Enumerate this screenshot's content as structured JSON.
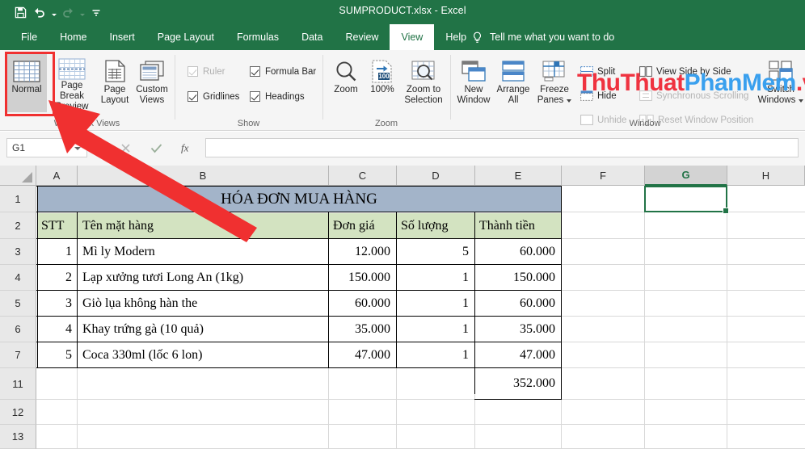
{
  "titlebar": {
    "document_title": "SUMPRODUCT.xlsx  -  Excel",
    "qat": [
      {
        "name": "save-icon",
        "label": "Save"
      },
      {
        "name": "undo-icon",
        "label": "Undo"
      },
      {
        "name": "redo-icon",
        "label": "Redo"
      },
      {
        "name": "customize-qat-icon",
        "label": "Customize Quick Access Toolbar"
      }
    ]
  },
  "ribbon_tabs": {
    "items": [
      {
        "label": "File",
        "active": false
      },
      {
        "label": "Home",
        "active": false
      },
      {
        "label": "Insert",
        "active": false
      },
      {
        "label": "Page Layout",
        "active": false
      },
      {
        "label": "Formulas",
        "active": false
      },
      {
        "label": "Data",
        "active": false
      },
      {
        "label": "Review",
        "active": false
      },
      {
        "label": "View",
        "active": true
      },
      {
        "label": "Help",
        "active": false
      }
    ],
    "tellme": "Tell me what you want to do"
  },
  "ribbon": {
    "groups": {
      "workbook_views": {
        "label": "Workbook Views",
        "buttons": [
          {
            "label": "Normal",
            "selected": true
          },
          {
            "label": "Page Break Preview",
            "line1": "Page Break",
            "line2": "Preview",
            "selected": false
          },
          {
            "label": "Page Layout",
            "line1": "Page",
            "line2": "Layout",
            "selected": false
          },
          {
            "label": "Custom Views",
            "line1": "Custom",
            "line2": "Views",
            "selected": false
          }
        ]
      },
      "show": {
        "label": "Show",
        "checkboxes": [
          {
            "label": "Ruler",
            "checked": true,
            "disabled": true
          },
          {
            "label": "Formula Bar",
            "checked": true,
            "disabled": false
          },
          {
            "label": "Gridlines",
            "checked": true,
            "disabled": false
          },
          {
            "label": "Headings",
            "checked": true,
            "disabled": false
          }
        ]
      },
      "zoom": {
        "label": "Zoom",
        "buttons": [
          {
            "label": "Zoom"
          },
          {
            "label": "100%"
          },
          {
            "label": "Zoom to Selection",
            "line1": "Zoom to",
            "line2": "Selection"
          }
        ]
      },
      "window": {
        "label": "Window",
        "big_buttons": [
          {
            "label": "New Window",
            "line1": "New",
            "line2": "Window"
          },
          {
            "label": "Arrange All",
            "line1": "Arrange",
            "line2": "All"
          },
          {
            "label": "Freeze Panes",
            "line1": "Freeze",
            "line2": "Panes"
          },
          {
            "label": "Switch Windows",
            "line1": "Switch",
            "line2": "Windows"
          }
        ],
        "small_buttons": [
          {
            "label": "Split",
            "disabled": false
          },
          {
            "label": "Hide",
            "disabled": false
          },
          {
            "label": "Unhide",
            "disabled": true
          },
          {
            "label": "View Side by Side",
            "disabled": false
          },
          {
            "label": "Synchronous Scrolling",
            "disabled": true
          },
          {
            "label": "Reset Window Position",
            "disabled": true
          }
        ]
      }
    }
  },
  "formula_bar": {
    "name_box_value": "G1",
    "formula_value": "",
    "cancel_icon": "cancel-icon",
    "enter_icon": "enter-icon",
    "function_icon": "insert-function-icon"
  },
  "sheet": {
    "columns": [
      "A",
      "B",
      "C",
      "D",
      "E",
      "F",
      "G",
      "H"
    ],
    "selected_column": "G",
    "rows": [
      "1",
      "2",
      "3",
      "4",
      "5",
      "6",
      "7",
      "11",
      "12",
      "13"
    ],
    "selected_cell": "G1",
    "title_row": {
      "text": "HÓA ĐƠN MUA HÀNG",
      "fill": "#a3b4c9"
    },
    "header_row": {
      "cells": [
        "STT",
        "Tên mặt hàng",
        "Đơn giá",
        "Số lượng",
        "Thành tiền"
      ],
      "fill": "#d3e3c1"
    },
    "data_rows": [
      {
        "row": "3",
        "stt": "1",
        "name": "Mì ly Modern",
        "price": "12.000",
        "qty": "5",
        "total": "60.000"
      },
      {
        "row": "4",
        "stt": "2",
        "name": "Lạp xưởng tươi Long An (1kg)",
        "price": "150.000",
        "qty": "1",
        "total": "150.000"
      },
      {
        "row": "5",
        "stt": "3",
        "name": "Giò lụa không hàn the",
        "price": "60.000",
        "qty": "1",
        "total": "60.000"
      },
      {
        "row": "6",
        "stt": "4",
        "name": "Khay trứng gà (10 quả)",
        "price": "35.000",
        "qty": "1",
        "total": "35.000"
      },
      {
        "row": "7",
        "stt": "5",
        "name": "Coca 330ml (lốc 6 lon)",
        "price": "47.000",
        "qty": "1",
        "total": "47.000"
      }
    ],
    "grand_total": {
      "row": "11",
      "value": "352.000"
    }
  },
  "annotations": {
    "highlight_box_target": "Normal",
    "arrow_color": "#f03030",
    "watermark": {
      "part1": "ThuThuat",
      "part2": "PhanMem",
      "part3": ".vn",
      "color1": "#ef3340",
      "color2": "#3aa0ee"
    }
  }
}
